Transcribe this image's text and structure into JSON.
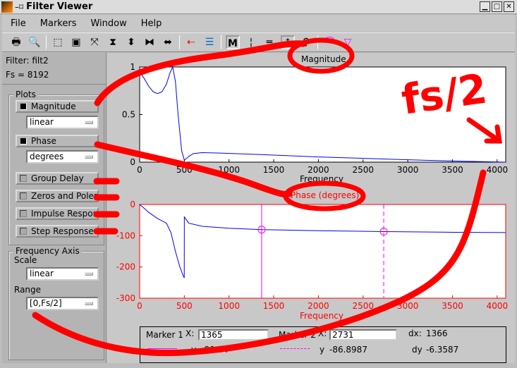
{
  "window": {
    "title": "Filter Viewer"
  },
  "menu": [
    "File",
    "Markers",
    "Window",
    "Help"
  ],
  "toolbar": {
    "icons": [
      "print-icon",
      "print-preview-icon",
      "zoom-box-icon",
      "zoom-all-icon",
      "full-view-icon",
      "zoom-y-in-icon",
      "zoom-y-out-icon",
      "zoom-x-in-icon",
      "zoom-x-out-icon",
      "legend-icon",
      "line-style-icon",
      "mouse-zoom-toggle-icon",
      "vertical-markers-icon",
      "horizontal-markers-icon",
      "track-markers-icon",
      "slope-markers-icon",
      "peak-icon",
      "valley-icon"
    ]
  },
  "filter": {
    "name": "Filter: filt2",
    "fs": "Fs = 8192"
  },
  "plots": {
    "label": "Plots",
    "magnitude": "Magnitude",
    "magnitude_scale": "linear",
    "phase": "Phase",
    "phase_units": "degrees",
    "group_delay": "Group Delay",
    "zeros_poles": "Zeros and Poles",
    "impulse": "Impulse Response",
    "step": "Step Response",
    "magnitude_on": true,
    "phase_on": true
  },
  "freq_axis": {
    "label": "Frequency Axis",
    "scale_label": "Scale",
    "scale": "linear",
    "range_label": "Range",
    "range": "[0,Fs/2]"
  },
  "chart_data": [
    {
      "type": "line",
      "title": "Magnitude",
      "xlabel": "Frequency",
      "xlim": [
        0,
        4096
      ],
      "ylim": [
        0,
        1
      ],
      "xticks": [
        0,
        500,
        1000,
        1500,
        2000,
        2500,
        3000,
        3500,
        4000
      ],
      "yticks": [
        0,
        0.5,
        1
      ],
      "color": "#0000ff",
      "x": [
        0,
        50,
        100,
        150,
        200,
        250,
        300,
        340,
        370,
        400,
        430,
        470,
        500,
        550,
        600,
        700,
        900,
        1200,
        1600,
        2000,
        2500,
        3000,
        3500,
        4096
      ],
      "y": [
        0.95,
        0.88,
        0.8,
        0.74,
        0.72,
        0.74,
        0.82,
        0.94,
        1.0,
        0.85,
        0.5,
        0.12,
        0.02,
        0.06,
        0.09,
        0.1,
        0.095,
        0.085,
        0.07,
        0.055,
        0.04,
        0.025,
        0.012,
        0.0
      ]
    },
    {
      "type": "line",
      "title": "Phase (degrees)",
      "xlabel": "Frequency",
      "xlim": [
        0,
        4096
      ],
      "ylim": [
        -300,
        0
      ],
      "xticks": [
        0,
        500,
        1000,
        1500,
        2000,
        2500,
        3000,
        3500,
        4000
      ],
      "yticks": [
        0,
        -100,
        -200,
        -300
      ],
      "color": "#0000ff",
      "axis_color": "#ff0000",
      "x": [
        0,
        50,
        100,
        200,
        300,
        350,
        400,
        450,
        490,
        499,
        500,
        550,
        700,
        1000,
        1365,
        2000,
        2731,
        3500,
        4096
      ],
      "y": [
        0,
        -12,
        -25,
        -45,
        -60,
        -90,
        -150,
        -200,
        -230,
        -235,
        -40,
        -60,
        -70,
        -76,
        -80.5,
        -84,
        -86.9,
        -89,
        -90
      ],
      "markers": [
        {
          "x": 1365,
          "y": -80.5,
          "style": "solid"
        },
        {
          "x": 2731,
          "y": -86.8987,
          "style": "dashed"
        }
      ],
      "marker_color": "#ff00ff"
    }
  ],
  "markers": {
    "m1_label": "Marker 1",
    "m2_label": "Marker 2",
    "x_label": "X:",
    "m1_x": "1365",
    "m2_x": "2731",
    "y_label": "y",
    "m1_y": "-80.54",
    "m2_y": "-86.8987",
    "dx_label": "dx:",
    "dx": "1366",
    "dy_label": "dy",
    "dy": "-6.3587"
  },
  "annotation": {
    "text": "fs/2",
    "color": "#ff0000"
  }
}
